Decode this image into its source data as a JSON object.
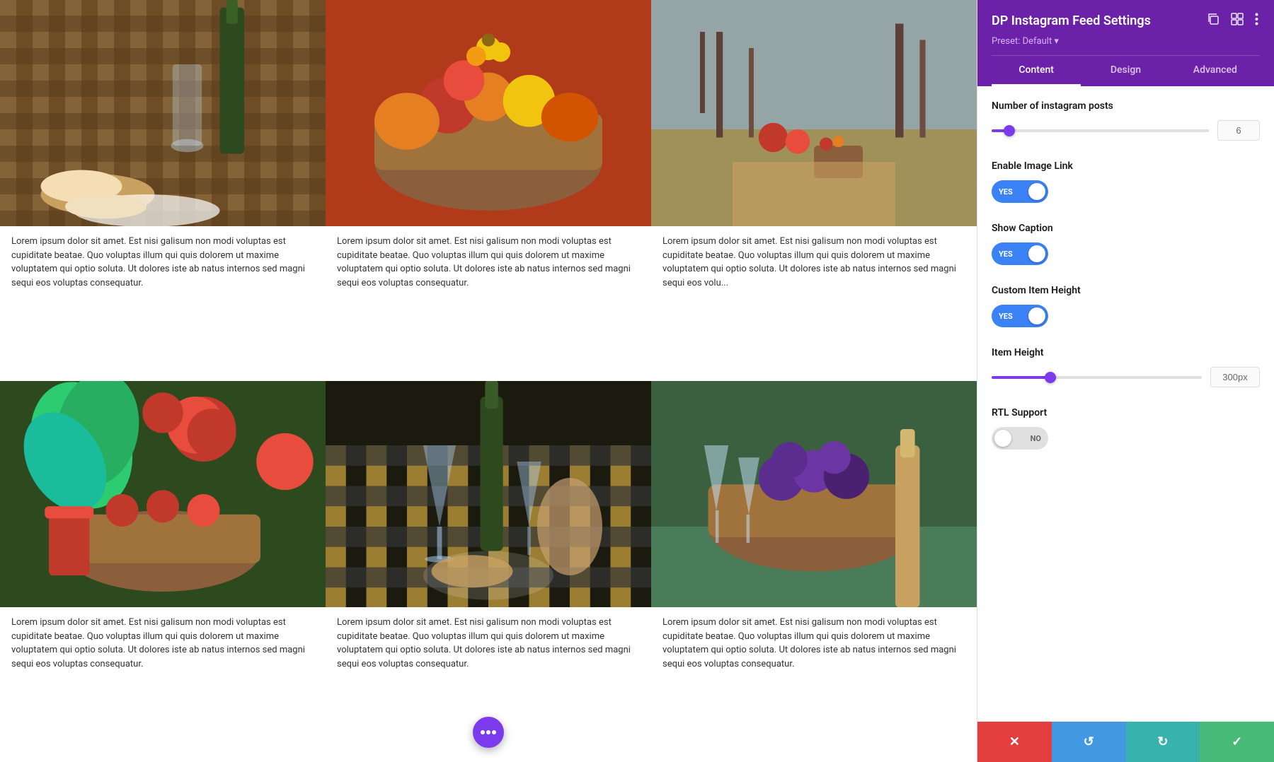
{
  "panel": {
    "title": "DP Instagram Feed Settings",
    "preset_label": "Preset: Default ▾",
    "tabs": [
      {
        "id": "content",
        "label": "Content",
        "active": true
      },
      {
        "id": "design",
        "label": "Design",
        "active": false
      },
      {
        "id": "advanced",
        "label": "Advanced",
        "active": false
      }
    ],
    "settings": {
      "num_posts": {
        "label": "Number of instagram posts",
        "value": 6,
        "min": 1,
        "max": 20,
        "slider_percent": 8
      },
      "enable_image_link": {
        "label": "Enable Image Link",
        "value": true,
        "yes_label": "YES",
        "no_label": "NO"
      },
      "show_caption": {
        "label": "Show Caption",
        "value": true,
        "yes_label": "YES",
        "no_label": "NO"
      },
      "custom_item_height": {
        "label": "Custom Item Height",
        "value": true,
        "yes_label": "YES",
        "no_label": "NO"
      },
      "item_height": {
        "label": "Item Height",
        "value": "300px",
        "min": 100,
        "max": 800,
        "slider_percent": 28
      },
      "rtl_support": {
        "label": "RTL Support",
        "value": false,
        "yes_label": "YES",
        "no_label": "NO"
      }
    },
    "footer": {
      "cancel_icon": "✕",
      "undo_icon": "↺",
      "redo_icon": "↻",
      "save_icon": "✓"
    }
  },
  "posts": [
    {
      "id": 1,
      "text": "Lorem ipsum dolor sit amet. Est nisi galisum non modi voluptas est cupiditate beatae. Quo voluptas illum qui quis dolorem ut maxime voluptatem qui optio soluta. Ut dolores iste ab natus internos sed magni sequi eos voluptas consequatur."
    },
    {
      "id": 2,
      "text": "Lorem ipsum dolor sit amet. Est nisi galisum non modi voluptas est cupiditate beatae. Quo voluptas illum qui quis dolorem ut maxime voluptatem qui optio soluta. Ut dolores iste ab natus internos sed magni sequi eos voluptas consequatur."
    },
    {
      "id": 3,
      "text": "Lorem ipsum dolor sit amet. Est nisi galisum non modi voluptas est cupiditate beatae. Quo voluptas illum qui quis dolorem ut maxime voluptatem qui optio soluta. Ut dolores iste ab natus internos sed magni sequi eos volu..."
    },
    {
      "id": 4,
      "text": "Lorem ipsum dolor sit amet. Est nisi galisum non modi voluptas est cupiditate beatae. Quo voluptas illum qui quis dolorem ut maxime voluptatem qui optio soluta. Ut dolores iste ab natus internos sed magni sequi eos voluptas consequatur."
    },
    {
      "id": 5,
      "text": "Lorem ipsum dolor sit amet. Est nisi galisum non modi voluptas est cupiditate beatae. Quo voluptas illum qui quis dolorem ut maxime voluptatem qui optio soluta. Ut dolores iste ab natus internos sed magni sequi eos voluptas consequatur."
    },
    {
      "id": 6,
      "text": "Lorem ipsum dolor sit amet. Est nisi galisum non modi voluptas est cupiditate beatae. Quo voluptas illum qui quis dolorem ut maxime voluptatem qui optio soluta. Ut dolores iste ab natus internos sed magni sequi eos voluptas consequatur."
    }
  ],
  "fab": {
    "icon": "•••"
  },
  "icons": {
    "copy": "⧉",
    "grid": "⊞",
    "more": "⋮"
  }
}
